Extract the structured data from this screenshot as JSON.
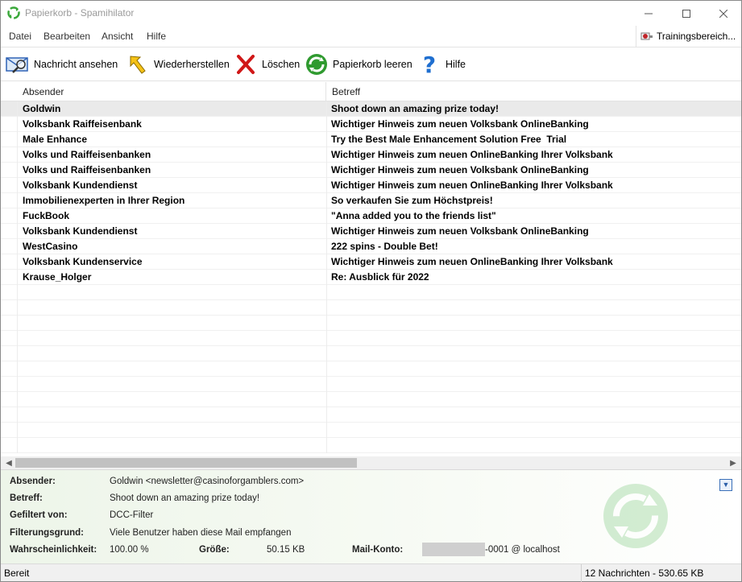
{
  "window": {
    "title": "Papierkorb - Spamihilator"
  },
  "menu": {
    "items": [
      "Datei",
      "Bearbeiten",
      "Ansicht",
      "Hilfe"
    ],
    "training_label": "Trainingsbereich..."
  },
  "toolbar": {
    "view_label": "Nachricht ansehen",
    "restore_label": "Wiederherstellen",
    "delete_label": "Löschen",
    "empty_label": "Papierkorb leeren",
    "help_label": "Hilfe"
  },
  "list": {
    "columns": {
      "sender": "Absender",
      "subject": "Betreff"
    },
    "rows": [
      {
        "sender": "Goldwin",
        "subject": "Shoot down an amazing prize today!"
      },
      {
        "sender": "Volksbank Raiffeisenbank",
        "subject": "Wichtiger Hinweis zum neuen Volksbank OnlineBanking"
      },
      {
        "sender": "Male Enhance",
        "subject": "Try the Best Male Enhancement Solution Free  Trial"
      },
      {
        "sender": "Volks und Raiffeisenbanken",
        "subject": "Wichtiger Hinweis zum neuen OnlineBanking Ihrer Volksbank"
      },
      {
        "sender": "Volks und Raiffeisenbanken",
        "subject": "Wichtiger Hinweis zum neuen Volksbank OnlineBanking"
      },
      {
        "sender": "Volksbank Kundendienst",
        "subject": "Wichtiger Hinweis zum neuen OnlineBanking Ihrer Volksbank"
      },
      {
        "sender": "Immobilienexperten in Ihrer Region",
        "subject": "So verkaufen Sie zum Höchstpreis!"
      },
      {
        "sender": "FuckBook",
        "subject": "\"Anna added you to the friends list\""
      },
      {
        "sender": "Volksbank Kundendienst",
        "subject": "Wichtiger Hinweis zum neuen Volksbank OnlineBanking"
      },
      {
        "sender": "WestCasino",
        "subject": "222 spins - Double Bet!"
      },
      {
        "sender": "Volksbank Kundenservice",
        "subject": "Wichtiger Hinweis zum neuen OnlineBanking Ihrer Volksbank"
      },
      {
        "sender": "Krause_Holger",
        "subject": "Re: Ausblick für 2022"
      }
    ],
    "selected_index": 0
  },
  "preview": {
    "sender_label": "Absender:",
    "sender_value": "Goldwin <newsletter@casinoforgamblers.com>",
    "subject_label": "Betreff:",
    "subject_value": "Shoot down an amazing prize today!",
    "filtered_label": "Gefiltert von:",
    "filtered_value": "DCC-Filter",
    "reason_label": "Filterungsgrund:",
    "reason_value": "Viele Benutzer haben diese Mail empfangen",
    "prob_label": "Wahrscheinlichkeit:",
    "prob_value": "100.00 %",
    "size_label": "Größe:",
    "size_value": "50.15 KB",
    "account_label": "Mail-Konto:",
    "account_value": "-0001 @ localhost"
  },
  "status": {
    "left": "Bereit",
    "right": "12 Nachrichten - 530.65 KB"
  },
  "colors": {
    "accent_green": "#3aa83a",
    "help_blue": "#1f6fd0",
    "delete_red": "#d01818"
  }
}
